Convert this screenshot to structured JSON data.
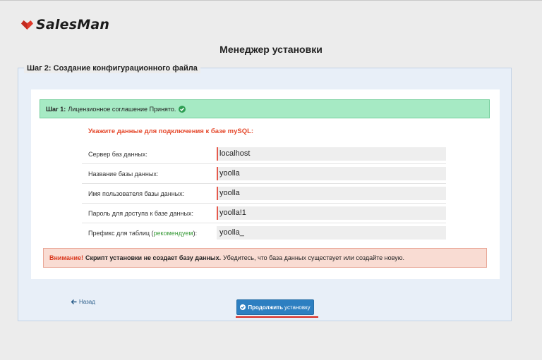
{
  "brand": {
    "name": "SalesMan",
    "color": "#e0382a"
  },
  "page_title": "Менеджер установки",
  "legend": "Шаг 2: Создание конфигурационного файла",
  "success": {
    "label": "Шаг 1:",
    "text": "Лицензионное соглашение Принято.",
    "icon": "check-circle-icon"
  },
  "db_section": {
    "title": "Укажите данные для подключения к базе mySQL:",
    "fields": [
      {
        "label": "Сервер баз данных:",
        "value": "localhost"
      },
      {
        "label": "Название базы данных:",
        "value": "yoolla"
      },
      {
        "label": "Имя пользователя базы данных:",
        "value": "yoolla"
      },
      {
        "label": "Пароль для доступа к базе данных:",
        "value": "yoolla!1"
      },
      {
        "label_before": "Префикс для таблиц (",
        "label_rec": "рекомендуем",
        "label_after": "):",
        "value": "yoolla_"
      }
    ]
  },
  "warning": {
    "label": "Внимание!",
    "bold": "Скрипт установки не создает базу данных.",
    "text": "Убедитесь, что база данных существует или создайте новую."
  },
  "nav": {
    "back_label": "Назад",
    "continue_bold": "Продолжить",
    "continue_rest": "установку"
  }
}
